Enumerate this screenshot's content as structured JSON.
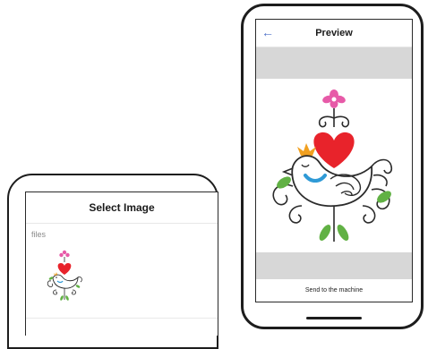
{
  "select_screen": {
    "title": "Select Image",
    "section_label": "files",
    "items": [
      {
        "icon": "embroidery-bird-icon"
      }
    ]
  },
  "preview_screen": {
    "back_icon": "back-arrow-icon",
    "back_glyph": "←",
    "title": "Preview",
    "action_label": "Send to the machine",
    "artwork_icon": "embroidery-bird-icon"
  },
  "colors": {
    "accent": "#4c70c8",
    "heart": "#e8232b",
    "flower": "#e75aa8",
    "leaf": "#61b144",
    "bird_line": "#2b2b2b",
    "crown": "#f1a020",
    "scarf": "#2f9ad6",
    "band": "#d7d7d7"
  }
}
